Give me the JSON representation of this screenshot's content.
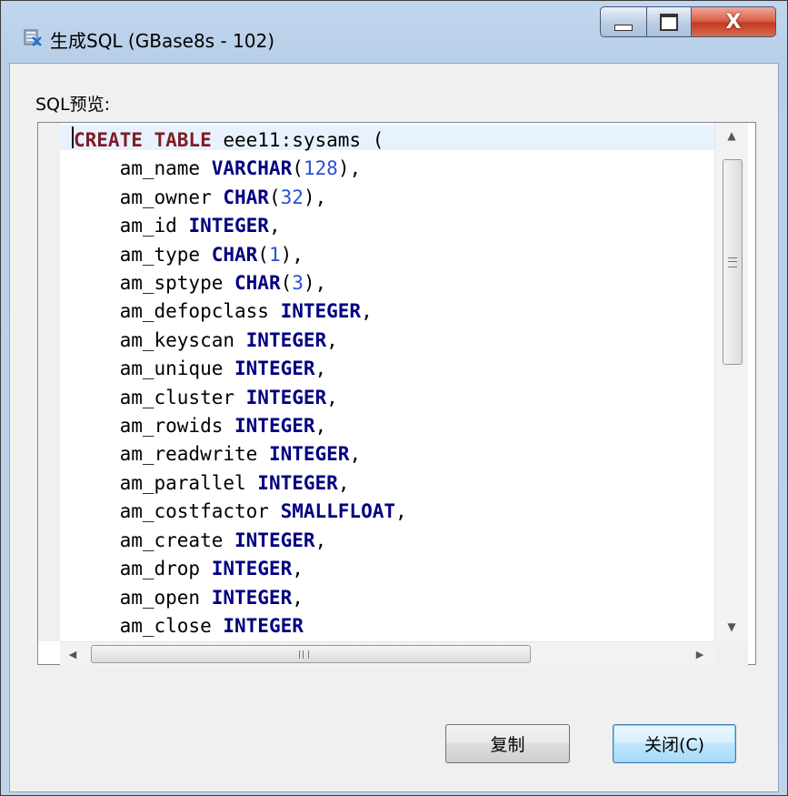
{
  "window": {
    "title": "生成SQL (GBase8s - 102)",
    "icon": "app-database-icon",
    "controls": {
      "minimize": "minimize-icon",
      "maximize": "maximize-icon",
      "close": "X"
    }
  },
  "label": "SQL预览:",
  "sql_lines": [
    [
      {
        "t": "CREATE TABLE",
        "c": "kw-create"
      },
      {
        "t": " eee11:sysams ("
      }
    ],
    [
      {
        "t": "    am_name "
      },
      {
        "t": "VARCHAR",
        "c": "kw-type"
      },
      {
        "t": "("
      },
      {
        "t": "128",
        "c": "num"
      },
      {
        "t": "),"
      }
    ],
    [
      {
        "t": "    am_owner "
      },
      {
        "t": "CHAR",
        "c": "kw-type"
      },
      {
        "t": "("
      },
      {
        "t": "32",
        "c": "num"
      },
      {
        "t": "),"
      }
    ],
    [
      {
        "t": "    am_id "
      },
      {
        "t": "INTEGER",
        "c": "kw-type"
      },
      {
        "t": ","
      }
    ],
    [
      {
        "t": "    am_type "
      },
      {
        "t": "CHAR",
        "c": "kw-type"
      },
      {
        "t": "("
      },
      {
        "t": "1",
        "c": "num"
      },
      {
        "t": "),"
      }
    ],
    [
      {
        "t": "    am_sptype "
      },
      {
        "t": "CHAR",
        "c": "kw-type"
      },
      {
        "t": "("
      },
      {
        "t": "3",
        "c": "num"
      },
      {
        "t": "),"
      }
    ],
    [
      {
        "t": "    am_defopclass "
      },
      {
        "t": "INTEGER",
        "c": "kw-type"
      },
      {
        "t": ","
      }
    ],
    [
      {
        "t": "    am_keyscan "
      },
      {
        "t": "INTEGER",
        "c": "kw-type"
      },
      {
        "t": ","
      }
    ],
    [
      {
        "t": "    am_unique "
      },
      {
        "t": "INTEGER",
        "c": "kw-type"
      },
      {
        "t": ","
      }
    ],
    [
      {
        "t": "    am_cluster "
      },
      {
        "t": "INTEGER",
        "c": "kw-type"
      },
      {
        "t": ","
      }
    ],
    [
      {
        "t": "    am_rowids "
      },
      {
        "t": "INTEGER",
        "c": "kw-type"
      },
      {
        "t": ","
      }
    ],
    [
      {
        "t": "    am_readwrite "
      },
      {
        "t": "INTEGER",
        "c": "kw-type"
      },
      {
        "t": ","
      }
    ],
    [
      {
        "t": "    am_parallel "
      },
      {
        "t": "INTEGER",
        "c": "kw-type"
      },
      {
        "t": ","
      }
    ],
    [
      {
        "t": "    am_costfactor "
      },
      {
        "t": "SMALLFLOAT",
        "c": "kw-type"
      },
      {
        "t": ","
      }
    ],
    [
      {
        "t": "    am_create "
      },
      {
        "t": "INTEGER",
        "c": "kw-type"
      },
      {
        "t": ","
      }
    ],
    [
      {
        "t": "    am_drop "
      },
      {
        "t": "INTEGER",
        "c": "kw-type"
      },
      {
        "t": ","
      }
    ],
    [
      {
        "t": "    am_open "
      },
      {
        "t": "INTEGER",
        "c": "kw-type"
      },
      {
        "t": ","
      }
    ],
    [
      {
        "t": "    am_close "
      },
      {
        "t": "INTEGER",
        "c": "kw-type"
      }
    ]
  ],
  "scrollbars": {
    "vertical": {
      "up": "▲",
      "down": "▼"
    },
    "horizontal": {
      "left": "◀",
      "right": "▶"
    }
  },
  "buttons": {
    "copy": "复制",
    "close": "关闭(C)"
  },
  "colors": {
    "keyword_create": "#7f1d25",
    "keyword_type": "#000080",
    "number": "#2a4fd6",
    "current_line": "#e8f2fe"
  }
}
